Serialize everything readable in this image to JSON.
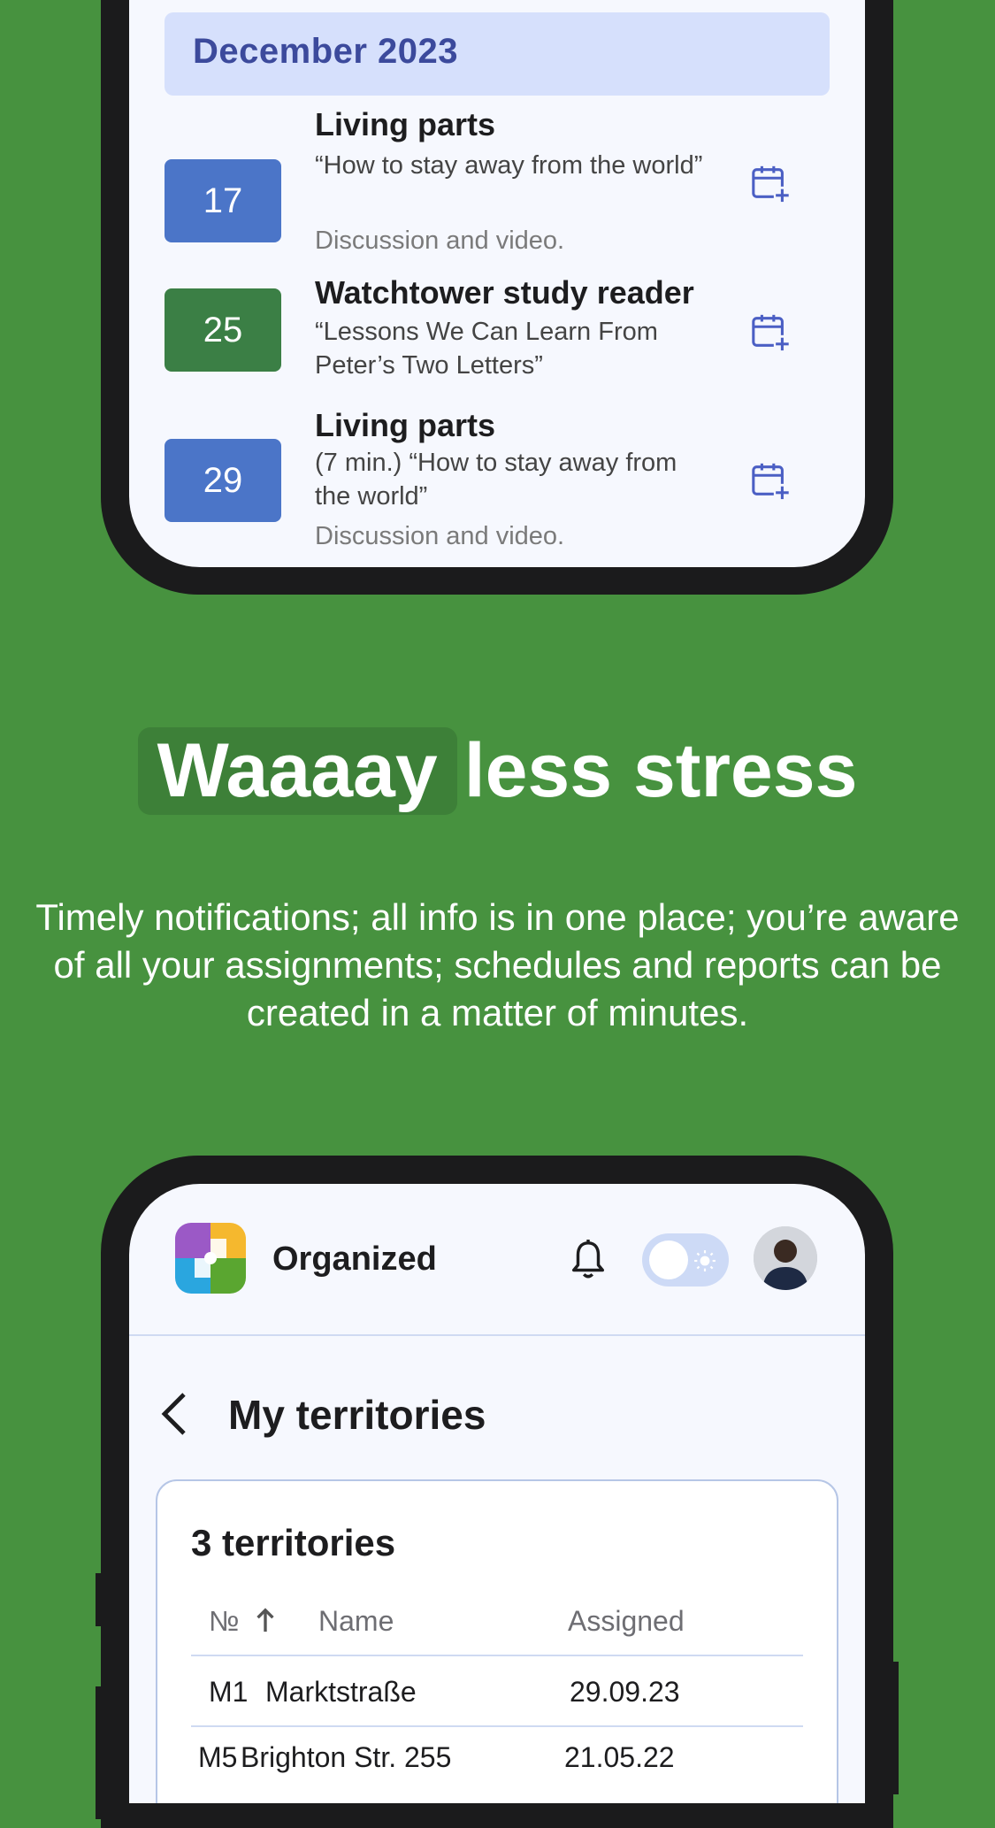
{
  "calendar": {
    "month": "December 2023",
    "events": [
      {
        "date": "17",
        "title": "Living parts",
        "subtitle": "“How to stay away from the world”",
        "description": "Discussion and video."
      },
      {
        "date": "25",
        "title": "Watchtower study reader",
        "subtitle": "“Lessons We Can Learn From Peter’s Two Letters”",
        "description": ""
      },
      {
        "date": "29",
        "title": "Living parts",
        "subtitle": "(7 min.) “How to stay away from the world”",
        "description": "Discussion and video."
      }
    ],
    "add_icon": "calendar-plus-icon"
  },
  "promo": {
    "headline_highlight": "Waaaay",
    "headline_rest": "less stress",
    "body": "Timely notifications; all info is in one place; you’re aware of all your assignments; schedules and reports can be created in a matter of minutes."
  },
  "app": {
    "name": "Organized",
    "bell_icon": "bell-icon",
    "theme_toggle": "light",
    "page_title": "My territories",
    "territories": {
      "count_label": "3 territories",
      "columns": [
        "№",
        "Name",
        "Assigned"
      ],
      "sort_icon": "arrow-up-icon",
      "rows": [
        {
          "num": "M1",
          "name": "Marktstraße",
          "assigned": "29.09.23"
        },
        {
          "num": "M5",
          "name": "Brighton Str. 255",
          "assigned": "21.05.22"
        }
      ]
    }
  },
  "colors": {
    "background": "#47923f",
    "accent_blue": "#4b75c8",
    "accent_green": "#3b7f45",
    "month_bar": "#d6e0fc"
  }
}
